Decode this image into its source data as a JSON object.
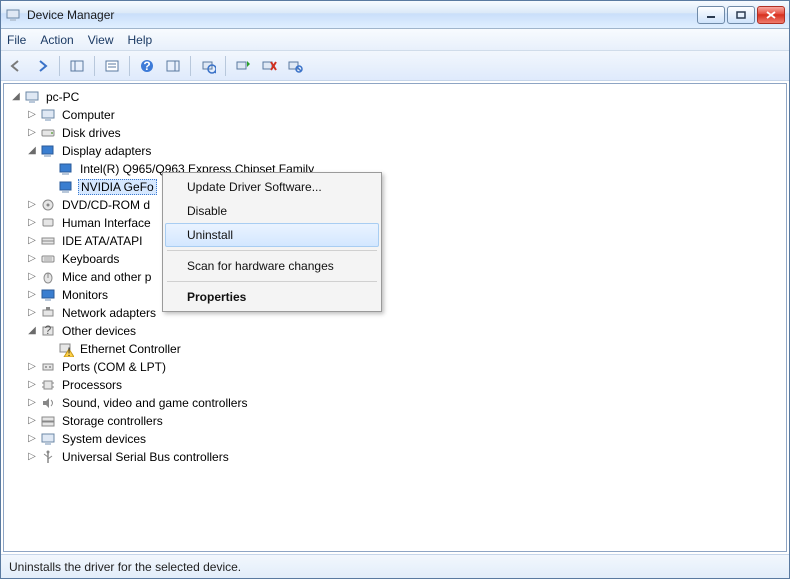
{
  "window": {
    "title": "Device Manager"
  },
  "menus": {
    "file": "File",
    "action": "Action",
    "view": "View",
    "help": "Help"
  },
  "tree": {
    "root": "pc-PC",
    "items": [
      {
        "label": "Computer"
      },
      {
        "label": "Disk drives"
      },
      {
        "label": "Display adapters",
        "expanded": true,
        "children": [
          {
            "label": "Intel(R)  Q965/Q963 Express Chipset Family"
          },
          {
            "label": "NVIDIA GeFo",
            "selected": true
          }
        ]
      },
      {
        "label": "DVD/CD-ROM d"
      },
      {
        "label": "Human Interface"
      },
      {
        "label": "IDE ATA/ATAPI"
      },
      {
        "label": "Keyboards"
      },
      {
        "label": "Mice and other p"
      },
      {
        "label": "Monitors"
      },
      {
        "label": "Network adapters"
      },
      {
        "label": "Other devices",
        "expanded": true,
        "children": [
          {
            "label": "Ethernet Controller",
            "warn": true
          }
        ]
      },
      {
        "label": "Ports (COM & LPT)"
      },
      {
        "label": "Processors"
      },
      {
        "label": "Sound, video and game controllers"
      },
      {
        "label": "Storage controllers"
      },
      {
        "label": "System devices"
      },
      {
        "label": "Universal Serial Bus controllers"
      }
    ]
  },
  "context_menu": {
    "update": "Update Driver Software...",
    "disable": "Disable",
    "uninstall": "Uninstall",
    "scan": "Scan for hardware changes",
    "properties": "Properties"
  },
  "status": "Uninstalls the driver for the selected device."
}
